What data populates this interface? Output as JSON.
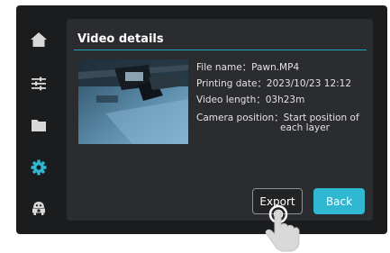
{
  "panel": {
    "title": "Video details"
  },
  "info": {
    "file_name": "File name：Pawn.MP4",
    "printing_date": "Printing date：2023/10/23 12:12",
    "video_length": "Video length：03h23m",
    "camera_position_1": "Camera position：Start position of",
    "camera_position_2": "each layer"
  },
  "buttons": {
    "export": "Export",
    "back": "Back"
  },
  "sidebar": {
    "items": [
      {
        "icon": "home-icon",
        "active": false
      },
      {
        "icon": "sliders-icon",
        "active": false
      },
      {
        "icon": "folder-icon",
        "active": false
      },
      {
        "icon": "gear-icon",
        "active": true
      },
      {
        "icon": "robot-icon",
        "active": false
      }
    ]
  },
  "colors": {
    "accent": "#30b8d3",
    "icon": "#d8d8d8",
    "panel": "#2b2c2f",
    "background": "#1b1c1e"
  }
}
